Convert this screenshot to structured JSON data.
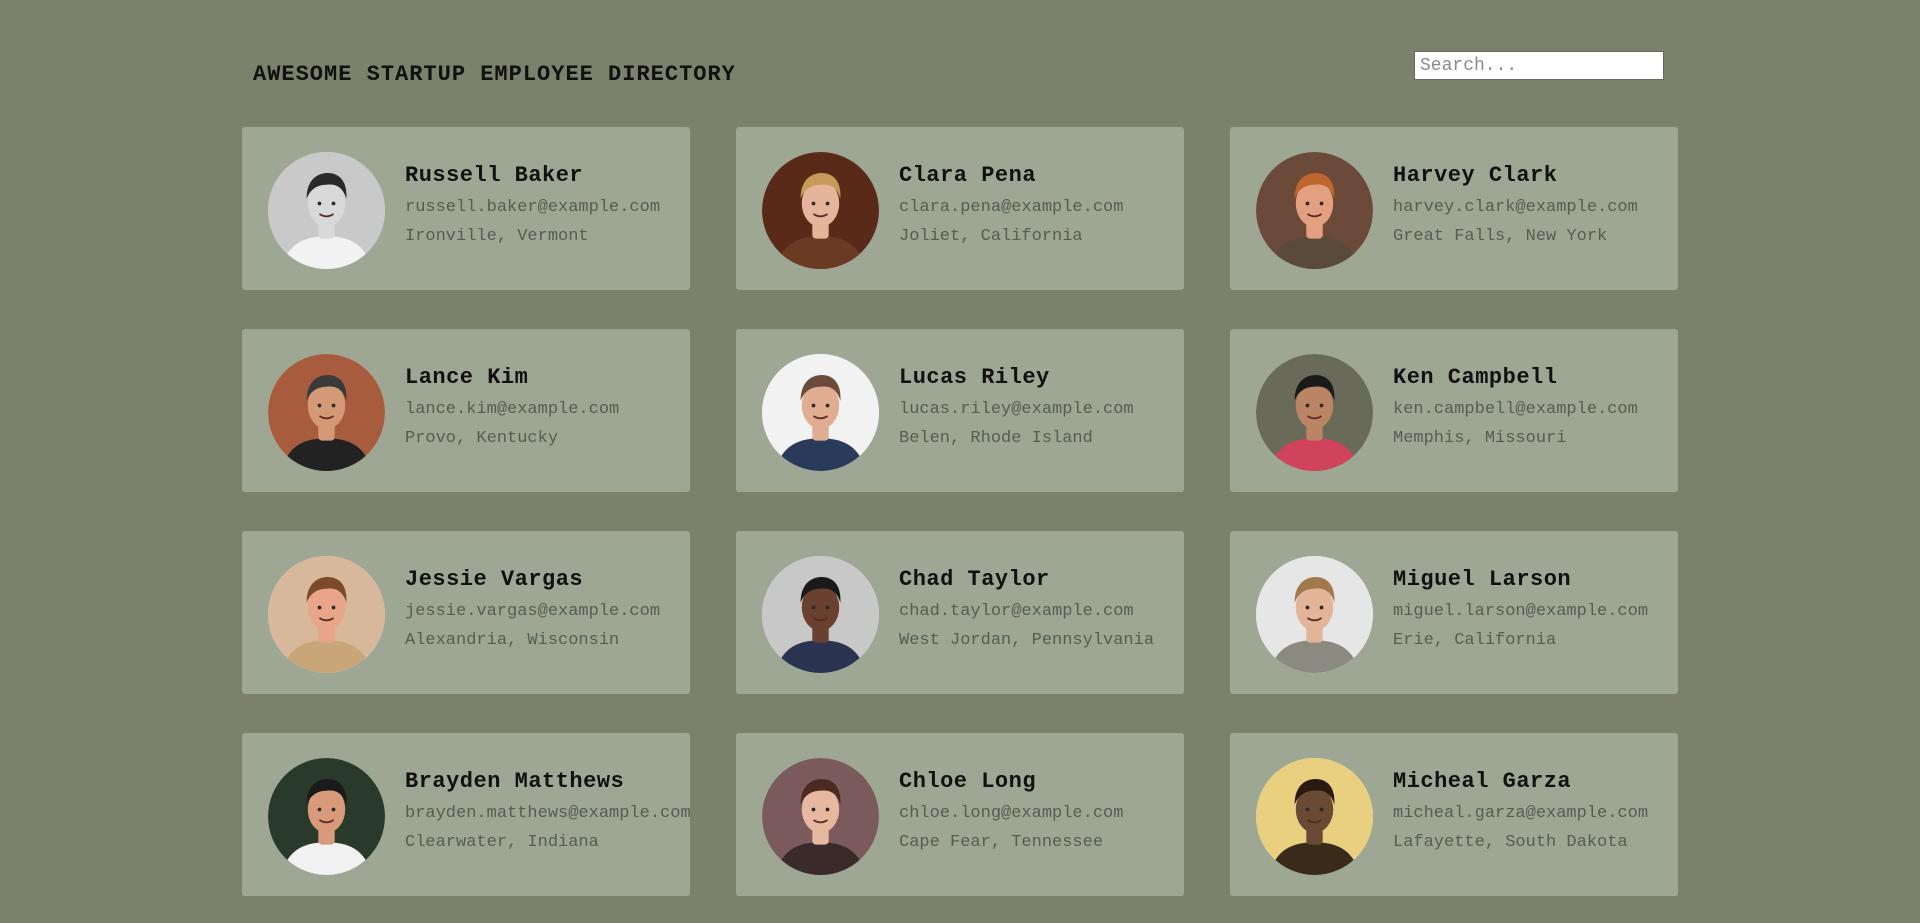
{
  "header": {
    "title": "AWESOME STARTUP EMPLOYEE DIRECTORY"
  },
  "search": {
    "placeholder": "Search...",
    "value": ""
  },
  "employees": [
    {
      "name": "Russell Baker",
      "email": "russell.baker@example.com",
      "location": "Ironville, Vermont",
      "avatar": {
        "skin": "#d9d9d9",
        "hair": "#2a2a2a",
        "shirt": "#f2f2f2",
        "bg": "#c9c9c9"
      }
    },
    {
      "name": "Clara Pena",
      "email": "clara.pena@example.com",
      "location": "Joliet, California",
      "avatar": {
        "skin": "#e6b49a",
        "hair": "#c89a5a",
        "shirt": "#6b3a22",
        "bg": "#5a2a18"
      }
    },
    {
      "name": "Harvey Clark",
      "email": "harvey.clark@example.com",
      "location": "Great Falls, New York",
      "avatar": {
        "skin": "#e3a081",
        "hair": "#c0652d",
        "shirt": "#5a4a3a",
        "bg": "#6b4a3a"
      }
    },
    {
      "name": "Lance Kim",
      "email": "lance.kim@example.com",
      "location": "Provo, Kentucky",
      "avatar": {
        "skin": "#d49a78",
        "hair": "#3a3a3a",
        "shirt": "#222222",
        "bg": "#a85c3e"
      }
    },
    {
      "name": "Lucas Riley",
      "email": "lucas.riley@example.com",
      "location": "Belen, Rhode Island",
      "avatar": {
        "skin": "#e0ad92",
        "hair": "#6b4c3a",
        "shirt": "#2a3a5a",
        "bg": "#f2f2f2"
      }
    },
    {
      "name": "Ken Campbell",
      "email": "ken.campbell@example.com",
      "location": "Memphis, Missouri",
      "avatar": {
        "skin": "#b98565",
        "hair": "#1a1a1a",
        "shirt": "#d0435a",
        "bg": "#6a6a5a"
      }
    },
    {
      "name": "Jessie Vargas",
      "email": "jessie.vargas@example.com",
      "location": "Alexandria, Wisconsin",
      "avatar": {
        "skin": "#e8a58a",
        "hair": "#7a4a2a",
        "shirt": "#c9a57a",
        "bg": "#d8b89a"
      }
    },
    {
      "name": "Chad Taylor",
      "email": "chad.taylor@example.com",
      "location": "West Jordan, Pennsylvania",
      "avatar": {
        "skin": "#6a4030",
        "hair": "#1a1a1a",
        "shirt": "#2a3450",
        "bg": "#c8c8c8"
      }
    },
    {
      "name": "Miguel Larson",
      "email": "miguel.larson@example.com",
      "location": "Erie, California",
      "avatar": {
        "skin": "#e2b598",
        "hair": "#a07a4a",
        "shirt": "#8a8a80",
        "bg": "#e6e6e6"
      }
    },
    {
      "name": "Brayden Matthews",
      "email": "brayden.matthews@example.com",
      "location": "Clearwater, Indiana",
      "avatar": {
        "skin": "#d89a7a",
        "hair": "#1a1a1a",
        "shirt": "#f2f2f2",
        "bg": "#2a3a2a"
      }
    },
    {
      "name": "Chloe Long",
      "email": "chloe.long@example.com",
      "location": "Cape Fear, Tennessee",
      "avatar": {
        "skin": "#e6b8a0",
        "hair": "#4a2a22",
        "shirt": "#3a2a2a",
        "bg": "#7a5a5a"
      }
    },
    {
      "name": "Micheal Garza",
      "email": "micheal.garza@example.com",
      "location": "Lafayette, South Dakota",
      "avatar": {
        "skin": "#6a4a34",
        "hair": "#2a1a10",
        "shirt": "#3a2a1a",
        "bg": "#e8d080"
      }
    }
  ]
}
